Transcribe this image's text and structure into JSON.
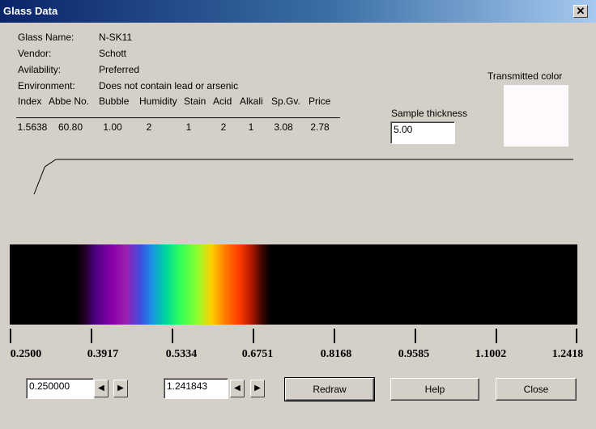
{
  "window": {
    "title": "Glass Data",
    "close_glyph": "✕"
  },
  "info": {
    "glass_name_label": "Glass Name:",
    "glass_name": "N-SK11",
    "vendor_label": "Vendor:",
    "vendor": "Schott",
    "availability_label": "Avilability:",
    "availability": "Preferred",
    "environment_label": "Environment:",
    "environment": "Does not contain lead or arsenic"
  },
  "table": {
    "headers": [
      "Index",
      "Abbe No.",
      "Bubble",
      "Humidity",
      "Stain",
      "Acid",
      "Alkali",
      "Sp.Gv.",
      "Price"
    ],
    "values": [
      "1.5638",
      "60.80",
      "1.00",
      "2",
      "1",
      "2",
      "1",
      "3.08",
      "2.78"
    ]
  },
  "sample_thickness": {
    "label": "Sample thickness",
    "value": "5.00"
  },
  "transmitted_color": {
    "label": "Transmitted color",
    "color": "#fdf9fc"
  },
  "axis": {
    "ticks": [
      "0.2500",
      "0.3917",
      "0.5334",
      "0.6751",
      "0.8168",
      "0.9585",
      "1.1002",
      "1.2418"
    ]
  },
  "range": {
    "min_value": "0.250000",
    "max_value": "1.241843"
  },
  "buttons": {
    "redraw": "Redraw",
    "help": "Help",
    "close": "Close"
  },
  "spin_glyphs": {
    "left": "◀",
    "right": "▶"
  },
  "chart_data": {
    "type": "line",
    "x": [
      0.25,
      0.27,
      0.29,
      0.31,
      0.33,
      0.35,
      0.4,
      0.5,
      0.7,
      1.0,
      1.2418
    ],
    "y": [
      0.28,
      0.62,
      0.83,
      0.93,
      0.97,
      0.99,
      1.0,
      1.0,
      1.0,
      1.0,
      1.0
    ],
    "xlim": [
      0.25,
      1.2418
    ],
    "ylim": [
      0,
      1
    ]
  }
}
